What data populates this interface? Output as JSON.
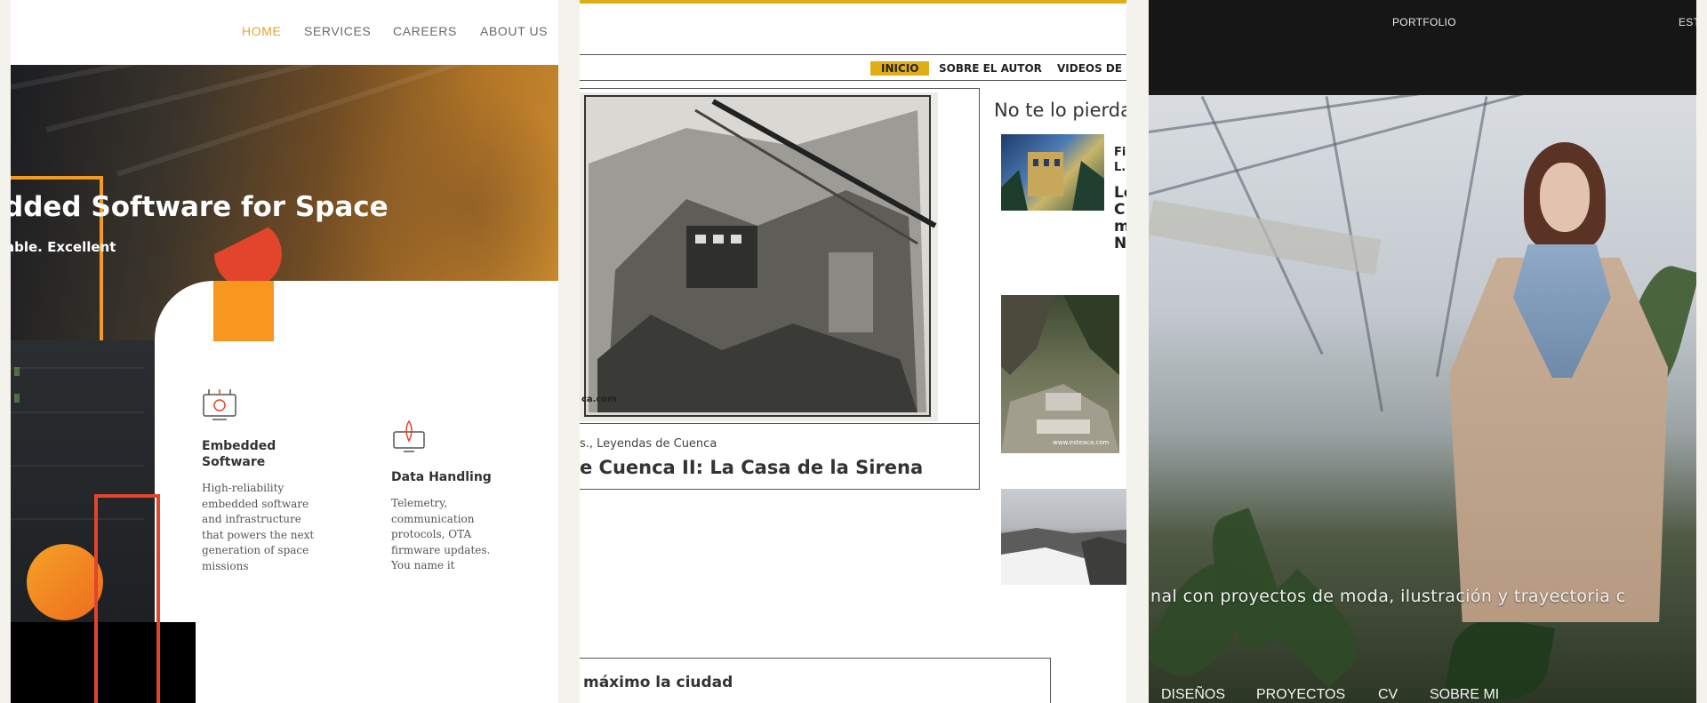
{
  "panel1": {
    "nav": [
      {
        "label": "HOME",
        "active": true
      },
      {
        "label": "SERVICES",
        "active": false
      },
      {
        "label": "CAREERS",
        "active": false
      },
      {
        "label": "ABOUT US",
        "active": false
      }
    ],
    "hero_title": "dded Software for Space",
    "hero_subtitle": "able. Excellent",
    "features": [
      {
        "icon": "embedded-board-icon",
        "title_line1": "Embedded",
        "title_line2": "Software",
        "desc": [
          "High-reliability",
          "embedded software",
          "and infrastructure",
          "that powers the next",
          "generation of space",
          "missions"
        ]
      },
      {
        "icon": "rocket-monitor-icon",
        "title_line1": "Data Handling",
        "title_line2": "",
        "desc": [
          "Telemetry,",
          "communication",
          "protocols, OTA",
          "firmware updates.",
          "You name it"
        ]
      }
    ],
    "colors": {
      "accent": "#e3a232",
      "orange": "#f7971e",
      "red": "#e2452c"
    }
  },
  "panel2": {
    "menu": [
      {
        "label": "INICIO",
        "active": true
      },
      {
        "label": "SOBRE EL AUTOR",
        "active": false
      },
      {
        "label": "VIDEOS DE C",
        "active": false
      }
    ],
    "post_image_watermark": "ca.com",
    "post_categories": "s., Leyendas de Cuenca",
    "post_title": "e Cuenca II: La Casa de la Sirena",
    "sidebar_title": "No te lo pierda",
    "side_items": [
      {
        "line1": "Fi",
        "line2": "L...",
        "line3": "Le",
        "line4": "C",
        "line5": "m",
        "line6": "N"
      }
    ],
    "thumb2_watermark": "www.esteaca.com",
    "bottom_post_title": "máximo la ciudad",
    "colors": {
      "accent": "#e0ae14"
    }
  },
  "panel3": {
    "header": [
      "PORTFOLIO",
      "EST"
    ],
    "tagline": "nal con proyectos de moda, ilustración y trayectoria c",
    "bottom_nav": [
      "DISEÑOS",
      "PROYECTOS",
      "CV",
      "SOBRE MI"
    ]
  }
}
